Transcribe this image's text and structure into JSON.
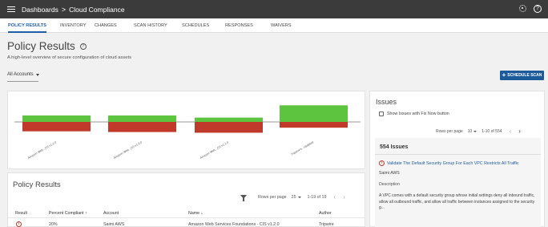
{
  "header": {
    "crumb_root": "Dashboards",
    "crumb_separator": ">",
    "crumb_current": "Cloud Compliance",
    "settings_icon": "gear-icon",
    "help_icon": "help-icon",
    "help_glyph": "?"
  },
  "tabs": [
    {
      "label": "POLICY RESULTS",
      "active": true
    },
    {
      "label": "INVENTORY",
      "active": false
    },
    {
      "label": "CHANGES",
      "active": false
    },
    {
      "label": "SCAN HISTORY",
      "active": false
    },
    {
      "label": "SCHEDULES",
      "active": false
    },
    {
      "label": "RESPONSES",
      "active": false
    },
    {
      "label": "WAIVERS",
      "active": false
    }
  ],
  "page": {
    "title": "Policy Results",
    "help_glyph": "?",
    "subtitle": "A high-level overview of secure configuration of cloud assets",
    "account_filter": "All Accounts",
    "schedule_button": "SCHEDULE SCAN",
    "schedule_plus": "+"
  },
  "chart_data": {
    "type": "bar",
    "subtype": "diverging-stacked",
    "categories": [
      "Amazon Web...OS v1.2.0",
      "Amazon Web...OS v1.2.0",
      "Amazon Web...OS v1.2.0",
      "Tripwire's...Updated"
    ],
    "series": [
      {
        "color": "#5cc43f",
        "values": [
          0.09,
          0.09,
          0.06,
          0.23
        ]
      },
      {
        "color": "#c0392b",
        "values": [
          -0.13,
          -0.14,
          -0.15,
          -0.08
        ]
      }
    ],
    "colors": {
      "pass": "#5cc43f",
      "fail": "#c0392b"
    }
  },
  "policy_results": {
    "title": "Policy Results",
    "filter_icon": "filter-icon",
    "rows_per_page_label": "Rows per page",
    "rows_per_page_value": "25",
    "range": "1-19 of 19",
    "prev": "‹",
    "next": "›",
    "columns": {
      "result": "Result",
      "percent": "Percent Compliant",
      "percent_sort": "↑",
      "account": "Account",
      "name": "Name",
      "name_sort": "↓",
      "author": "Author"
    },
    "rows": [
      {
        "result_icon": "alert-circle-icon",
        "result_glyph": "!",
        "percent": "20%",
        "account": "Saimi AWS",
        "name": "Amazon Web Services Foundations - CIS v1.2.0",
        "author": "Tripwire"
      }
    ]
  },
  "issues": {
    "title": "Issues",
    "fix_now_label": "Show Issues with Fix Now button",
    "rows_per_page_label": "Rows per page",
    "rows_per_page_value": "10",
    "range": "1-10 of 554",
    "prev": "‹",
    "next": "›",
    "count": "554 Issues",
    "item": {
      "icon": "alert-circle-icon",
      "icon_glyph": "!",
      "title": "Validate The Default Security Group For Each VPC Restricts All Traffic",
      "account": "Saimi AWS",
      "description_label": "Description",
      "description": "A VPC comes with a default security group whose initial settings deny all inbound traffic, allow all outbound traffic, and allow all traffic between instances assigned to the security g..."
    }
  }
}
